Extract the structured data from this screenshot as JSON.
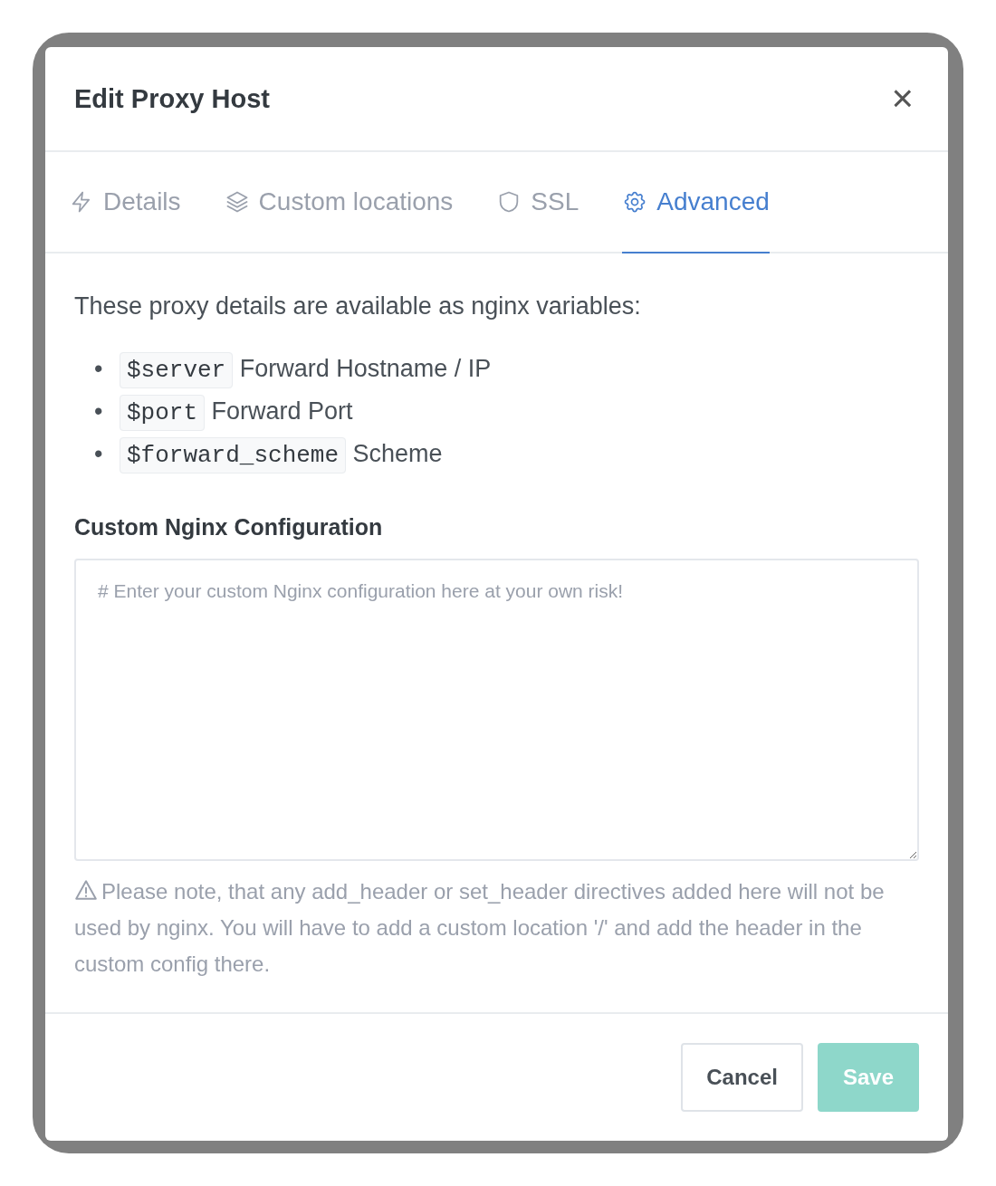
{
  "dialog": {
    "title": "Edit Proxy Host",
    "close_label": "×"
  },
  "tabs": [
    {
      "label": "Details",
      "selected": false
    },
    {
      "label": "Custom locations",
      "selected": false
    },
    {
      "label": "SSL",
      "selected": false
    },
    {
      "label": "Advanced",
      "selected": true
    }
  ],
  "intro": "These proxy details are available as nginx variables:",
  "variables": [
    {
      "marker": "•",
      "code": "$server",
      "description": "Forward Hostname / IP"
    },
    {
      "marker": "•",
      "code": "$port",
      "description": "Forward Port"
    },
    {
      "marker": "•",
      "code": "$forward_scheme",
      "description": "Scheme"
    }
  ],
  "config": {
    "label": "Custom Nginx Configuration",
    "placeholder": "# Enter your custom Nginx configuration here at your own risk!"
  },
  "note": "Please note, that any add_header or set_header directives added here will not be used by nginx. You will have to add a custom location '/' and add the header in the custom config there.",
  "buttons": [
    {
      "label": "Cancel",
      "kind": "secondary",
      "disabled": false
    },
    {
      "label": "Save",
      "kind": "primary",
      "disabled": true
    }
  ]
}
